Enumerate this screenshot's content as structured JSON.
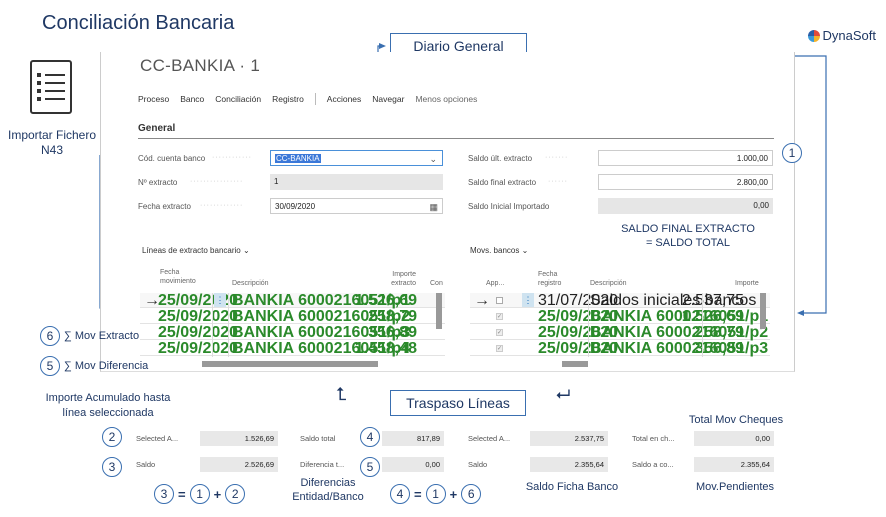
{
  "title": "Conciliación Bancaria",
  "logo": "DynaSoft",
  "diario_general": "Diario General",
  "traspaso_lineas": "Traspaso Líneas",
  "importar": "Importar Fichero\nN43",
  "page": {
    "title": "CC-BANKIA · 1",
    "menu": [
      "Proceso",
      "Banco",
      "Conciliación",
      "Registro",
      "Acciones",
      "Navegar",
      "Menos opciones"
    ],
    "section": "General"
  },
  "fields": {
    "cod_cuenta_label": "Cód. cuenta banco",
    "cod_cuenta_value": "CC-BANKIA",
    "n_extracto_label": "Nº extracto",
    "n_extracto_value": "1",
    "fecha_extracto_label": "Fecha extracto",
    "fecha_extracto_value": "30/09/2020",
    "saldo_ult_label": "Saldo últ. extracto",
    "saldo_ult_value": "1.000,00",
    "saldo_final_label": "Saldo final extracto",
    "saldo_final_value": "2.800,00",
    "saldo_inicial_label": "Saldo Inicial Importado",
    "saldo_inicial_value": "0,00"
  },
  "saldo_final_note": "SALDO FINAL EXTRACTO\n= SALDO TOTAL",
  "left_grid": {
    "title": "Líneas de extracto bancario",
    "headers": [
      "Fecha\nmovimiento",
      "Descripción",
      "Importe\nextracto",
      "Con"
    ],
    "rows": [
      {
        "date": "25/09/2020",
        "desc": "BANKIA 6000216051/p1",
        "amount": "1.526,69"
      },
      {
        "date": "25/09/2020",
        "desc": "BANKIA 6000216051/p2",
        "amount": "258,79"
      },
      {
        "date": "25/09/2020",
        "desc": "BANKIA 6000216051/p3",
        "amount": "356,89"
      },
      {
        "date": "25/09/2020",
        "desc": "BANKIA 6000216051/p4",
        "amount": "1.458,48"
      }
    ]
  },
  "right_grid": {
    "title": "Movs. bancos",
    "headers": [
      "App...",
      "Fecha\nregistro",
      "Descripción",
      "Importe"
    ],
    "rows": [
      {
        "date": "31/07/2020",
        "desc": "Saldos iniciales bancos",
        "amount": "2.537,75",
        "green": false
      },
      {
        "date": "25/09/2020",
        "desc": "BANKIA 6000216051/p1",
        "amount": "1.526,69",
        "green": true
      },
      {
        "date": "25/09/2020",
        "desc": "BANKIA 6000216051/p2",
        "amount": "258,79",
        "green": true
      },
      {
        "date": "25/09/2020",
        "desc": "BANKIA 6000216051/p3",
        "amount": "356,89",
        "green": true
      }
    ]
  },
  "annotations": {
    "sum_mov_extracto": "∑ Mov Extracto",
    "sum_mov_diferencia": "∑ Mov Diferencia",
    "importe_acumulado": "Importe Acumulado hasta\nlínea seleccionada",
    "diferencias": "Diferencias\nEntidad/Banco",
    "saldo_ficha": "Saldo Ficha Banco",
    "total_mov_cheques": "Total Mov Cheques",
    "mov_pendientes": "Mov.Pendientes"
  },
  "totals": {
    "selected_label": "Selected A...",
    "selected_value": "1.526,69",
    "saldo_label": "Saldo",
    "saldo_value": "2.526,69",
    "saldo_total_label": "Saldo total",
    "saldo_total_value": "817,89",
    "diferencia_label": "Diferencia t...",
    "diferencia_value": "0,00",
    "selected2_label": "Selected A...",
    "selected2_value": "2.537,75",
    "saldo2_label": "Saldo",
    "saldo2_value": "2.355,64",
    "total_ch_label": "Total en ch...",
    "total_ch_value": "0,00",
    "saldo_co_label": "Saldo a co...",
    "saldo_co_value": "2.355,64"
  },
  "nums": {
    "n1": "1",
    "n2": "2",
    "n3": "3",
    "n4": "4",
    "n5": "5",
    "n6": "6"
  },
  "colors": {
    "accent": "#1f3864",
    "green": "#2b8a2b",
    "select": "#3b78d8"
  }
}
